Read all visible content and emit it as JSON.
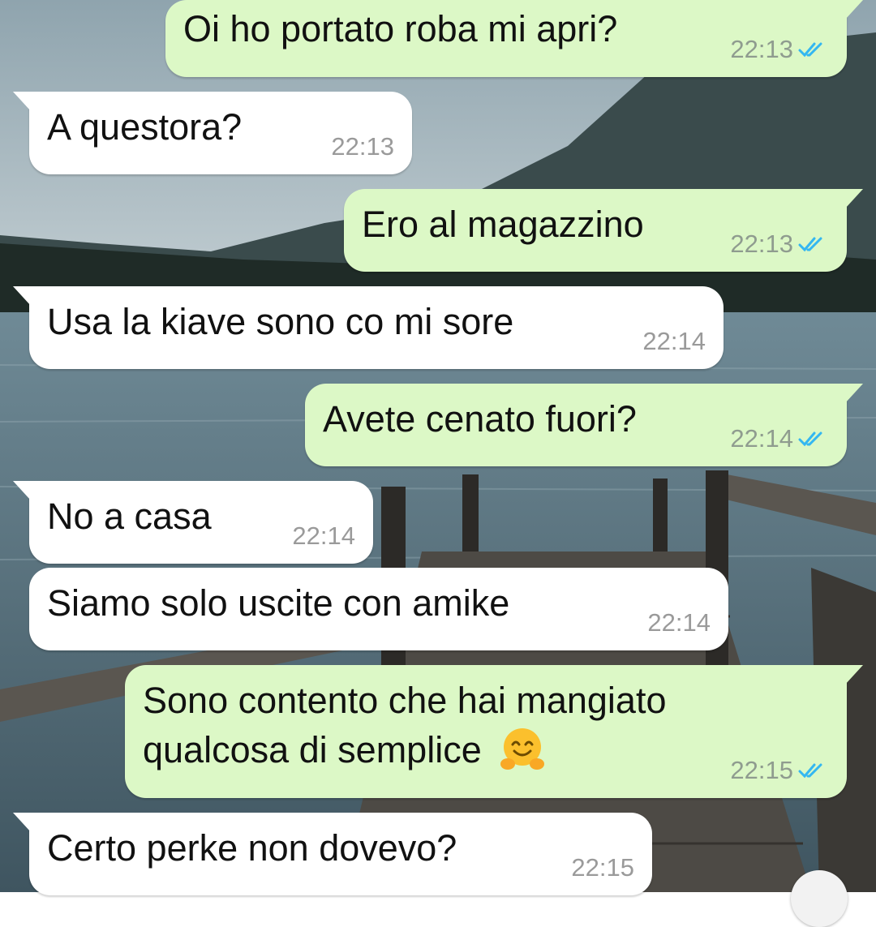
{
  "chat": {
    "messages": [
      {
        "direction": "out",
        "text": "Oi ho portato roba mi apri?",
        "time": "22:13",
        "status": "read"
      },
      {
        "direction": "in",
        "text": "A questora?",
        "time": "22:13"
      },
      {
        "direction": "out",
        "text": "Ero al magazzino",
        "time": "22:13",
        "status": "read"
      },
      {
        "direction": "in",
        "text": "Usa la kiave sono co mi sore",
        "time": "22:14"
      },
      {
        "direction": "out",
        "text": "Avete cenato fuori?",
        "time": "22:14",
        "status": "read"
      },
      {
        "direction": "in",
        "text": "No a casa",
        "time": "22:14"
      },
      {
        "direction": "in",
        "text": "Siamo solo uscite con amike",
        "time": "22:14"
      },
      {
        "direction": "out",
        "lines": [
          "Sono contento che hai mangiato",
          "qualcosa di semplice"
        ],
        "emoji": "hugging-face",
        "time": "22:15",
        "status": "read"
      },
      {
        "direction": "in",
        "text": "Certo perke non dovevo?",
        "time": "22:15"
      }
    ]
  },
  "colors": {
    "outgoing_bubble": "#dcf8c6",
    "incoming_bubble": "#ffffff",
    "read_receipt": "#34b7f1"
  },
  "icons": {
    "read_receipt": "double-check-icon",
    "emoji": "hugging-face-emoji",
    "scroll": "scroll-down-button"
  }
}
